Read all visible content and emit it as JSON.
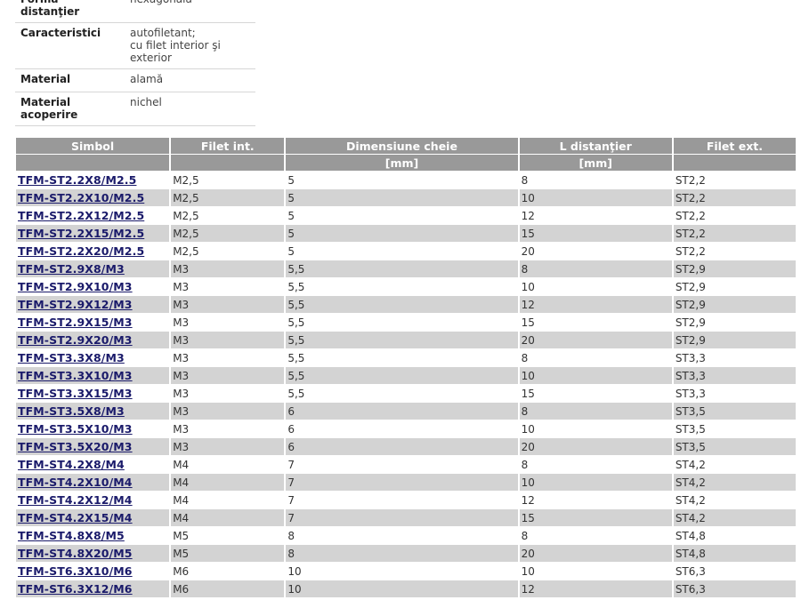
{
  "properties": [
    {
      "label": "Formă distanţier",
      "value": [
        "hexagonală"
      ]
    },
    {
      "label": "Caracteristici",
      "value": [
        "autofiletant;",
        "cu filet interior şi exterior"
      ]
    },
    {
      "label": "Material",
      "value": [
        "alamă"
      ]
    },
    {
      "label": "Material acoperire",
      "value": [
        "nichel"
      ]
    }
  ],
  "table": {
    "headers": [
      "Simbol",
      "Filet int.",
      "Dimensiune cheie",
      "L distanţier",
      "Filet ext."
    ],
    "units": [
      "",
      "",
      "[mm]",
      "[mm]",
      ""
    ],
    "rows": [
      [
        "TFM-ST2.2X8/M2.5",
        "M2,5",
        "5",
        "8",
        "ST2,2"
      ],
      [
        "TFM-ST2.2X10/M2.5",
        "M2,5",
        "5",
        "10",
        "ST2,2"
      ],
      [
        "TFM-ST2.2X12/M2.5",
        "M2,5",
        "5",
        "12",
        "ST2,2"
      ],
      [
        "TFM-ST2.2X15/M2.5",
        "M2,5",
        "5",
        "15",
        "ST2,2"
      ],
      [
        "TFM-ST2.2X20/M2.5",
        "M2,5",
        "5",
        "20",
        "ST2,2"
      ],
      [
        "TFM-ST2.9X8/M3",
        "M3",
        "5,5",
        "8",
        "ST2,9"
      ],
      [
        "TFM-ST2.9X10/M3",
        "M3",
        "5,5",
        "10",
        "ST2,9"
      ],
      [
        "TFM-ST2.9X12/M3",
        "M3",
        "5,5",
        "12",
        "ST2,9"
      ],
      [
        "TFM-ST2.9X15/M3",
        "M3",
        "5,5",
        "15",
        "ST2,9"
      ],
      [
        "TFM-ST2.9X20/M3",
        "M3",
        "5,5",
        "20",
        "ST2,9"
      ],
      [
        "TFM-ST3.3X8/M3",
        "M3",
        "5,5",
        "8",
        "ST3,3"
      ],
      [
        "TFM-ST3.3X10/M3",
        "M3",
        "5,5",
        "10",
        "ST3,3"
      ],
      [
        "TFM-ST3.3X15/M3",
        "M3",
        "5,5",
        "15",
        "ST3,3"
      ],
      [
        "TFM-ST3.5X8/M3",
        "M3",
        "6",
        "8",
        "ST3,5"
      ],
      [
        "TFM-ST3.5X10/M3",
        "M3",
        "6",
        "10",
        "ST3,5"
      ],
      [
        "TFM-ST3.5X20/M3",
        "M3",
        "6",
        "20",
        "ST3,5"
      ],
      [
        "TFM-ST4.2X8/M4",
        "M4",
        "7",
        "8",
        "ST4,2"
      ],
      [
        "TFM-ST4.2X10/M4",
        "M4",
        "7",
        "10",
        "ST4,2"
      ],
      [
        "TFM-ST4.2X12/M4",
        "M4",
        "7",
        "12",
        "ST4,2"
      ],
      [
        "TFM-ST4.2X15/M4",
        "M4",
        "7",
        "15",
        "ST4,2"
      ],
      [
        "TFM-ST4.8X8/M5",
        "M5",
        "8",
        "8",
        "ST4,8"
      ],
      [
        "TFM-ST4.8X20/M5",
        "M5",
        "8",
        "20",
        "ST4,8"
      ],
      [
        "TFM-ST6.3X10/M6",
        "M6",
        "10",
        "10",
        "ST6,3"
      ],
      [
        "TFM-ST6.3X12/M6",
        "M6",
        "10",
        "12",
        "ST6,3"
      ]
    ]
  },
  "colors": {
    "header_bg": "#999999",
    "row_alt_bg": "#d3d3d3",
    "link": "#1a1a6a"
  }
}
